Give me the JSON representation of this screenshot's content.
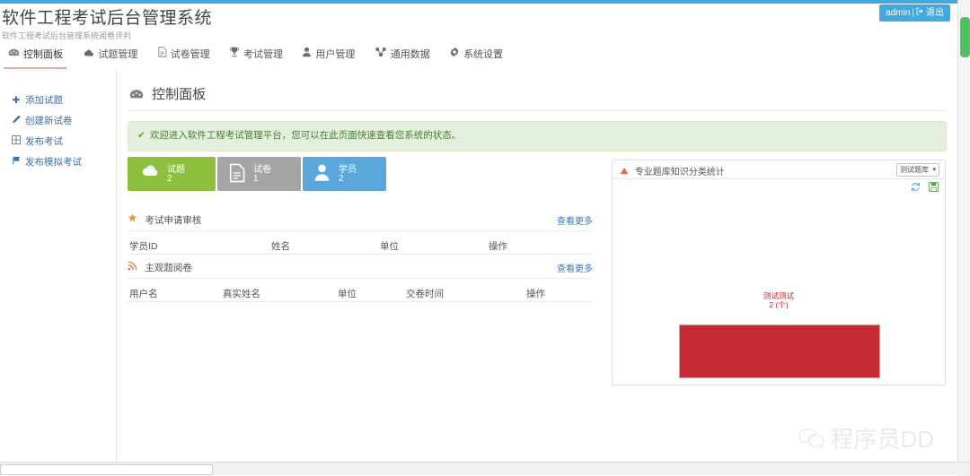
{
  "header": {
    "title": "软件工程考试后台管理系统",
    "subtitle": "软件工程考试后台管理系统阅卷评判",
    "user": "admin",
    "separator": "|",
    "logout_label": "退出",
    "accent_color": "#3fa9e0"
  },
  "nav": {
    "items": [
      {
        "label": "控制面板",
        "icon": "dashboard-icon",
        "active": true
      },
      {
        "label": "试题管理",
        "icon": "cloud-icon",
        "active": false
      },
      {
        "label": "试卷管理",
        "icon": "document-icon",
        "active": false
      },
      {
        "label": "考试管理",
        "icon": "trophy-icon",
        "active": false
      },
      {
        "label": "用户管理",
        "icon": "user-icon",
        "active": false
      },
      {
        "label": "通用数据",
        "icon": "share-icon",
        "active": false
      },
      {
        "label": "系统设置",
        "icon": "gear-icon",
        "active": false
      }
    ]
  },
  "sidebar": {
    "items": [
      {
        "label": "添加试题",
        "icon": "plus-icon"
      },
      {
        "label": "创建新试卷",
        "icon": "pencil-icon"
      },
      {
        "label": "发布考试",
        "icon": "calendar-icon"
      },
      {
        "label": "发布模拟考试",
        "icon": "flag-icon"
      }
    ]
  },
  "main": {
    "page_title": "控制面板",
    "page_title_icon": "dashboard-icon",
    "alert": {
      "icon": "check-icon",
      "text": "欢迎进入软件工程考试管理平台，您可以在此页面快速查看您系统的状态。",
      "bg_color": "#e4f0dc",
      "text_color": "#4c7a3b"
    },
    "tiles": [
      {
        "label": "试题",
        "value": "2",
        "color": "#8dbf3e",
        "icon": "cloud-icon"
      },
      {
        "label": "试卷",
        "value": "1",
        "color": "#a5a5a5",
        "icon": "document-icon"
      },
      {
        "label": "学员",
        "value": "2",
        "color": "#5ba7db",
        "icon": "user-icon"
      }
    ],
    "sections": [
      {
        "title": "考试申请审核",
        "icon": "star-icon",
        "icon_color": "#f0932b",
        "more_label": "查看更多",
        "columns": [
          "学员ID",
          "姓名",
          "单位",
          "操作"
        ],
        "rows": []
      },
      {
        "title": "主观题阅卷",
        "icon": "rss-icon",
        "icon_color": "#e8744b",
        "more_label": "查看更多",
        "columns": [
          "用户名",
          "真实姓名",
          "单位",
          "交卷时间",
          "操作"
        ],
        "rows": []
      }
    ]
  },
  "panel": {
    "title": "专业题库知识分类统计",
    "title_icon": "chart-icon",
    "select_value": "测试题库",
    "select_caret": "▾",
    "tools": [
      {
        "name": "refresh-icon",
        "color": "#5aa6dd"
      },
      {
        "name": "save-icon",
        "color": "#5aa340"
      }
    ]
  },
  "chart_data": {
    "type": "pie",
    "title": "专业题库知识分类统计",
    "categories": [
      "测试测试"
    ],
    "values": [
      2
    ],
    "unit": "个",
    "labels": [
      "测试测试",
      "2 (个)"
    ],
    "colors": [
      "#c62a32"
    ],
    "legend": "none",
    "grid": false
  },
  "watermark": {
    "text": "程序员DD",
    "icon": "wechat-icon"
  },
  "scrollbar": {
    "vertical_thumb_color": "#4cc261",
    "horizontal_track_color": "#f1f1f1"
  }
}
